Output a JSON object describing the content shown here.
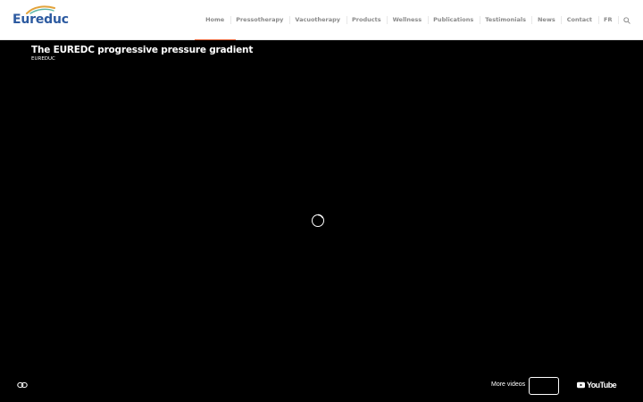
{
  "header": {
    "logo_text": "Eureduc",
    "nav": [
      {
        "label": "Home",
        "active": true
      },
      {
        "label": "Pressotherapy"
      },
      {
        "label": "Vacuotherapy"
      },
      {
        "label": "Products"
      },
      {
        "label": "Wellness"
      },
      {
        "label": "Publications"
      },
      {
        "label": "Testimonials"
      },
      {
        "label": "News"
      },
      {
        "label": "Contact"
      },
      {
        "label": "FR"
      }
    ],
    "search_icon": "search-icon"
  },
  "video": {
    "title": "The EUREDC progressive pressure gradient",
    "channel": "EUREDUC",
    "more_videos_label": "More videos",
    "youtube_label": "YouTube",
    "icons": [
      "link-icon",
      "loading-spinner-icon",
      "youtube-logo-icon"
    ]
  },
  "colors": {
    "nav_active_underline": "#e96a3f",
    "logo_blue": "#2c5aa0",
    "logo_swoosh_gold": "#e3a33b",
    "logo_swoosh_teal": "#5ab5a6"
  }
}
